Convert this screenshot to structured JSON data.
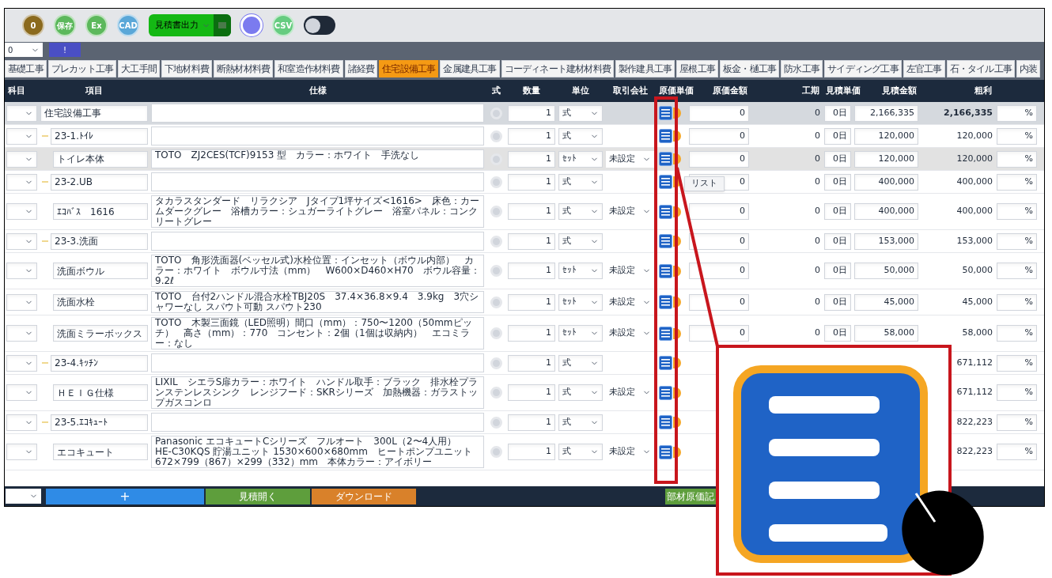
{
  "toolbar": [
    {
      "kind": "round",
      "label": "0",
      "color": "#8b6a1e"
    },
    {
      "kind": "round",
      "label": "保存",
      "color": "#5cb85c"
    },
    {
      "kind": "round",
      "label": "Ex",
      "color": "#5cb85c"
    },
    {
      "kind": "round",
      "label": "CAD",
      "color": "#5aa7d8"
    },
    {
      "kind": "dropdown",
      "label": "見積書出力",
      "color": "#14b814"
    },
    {
      "kind": "ring",
      "color": "#7b7bef"
    },
    {
      "kind": "round",
      "label": "CSV",
      "color": "#66cc80"
    },
    {
      "kind": "toggle",
      "on": false
    }
  ],
  "subbar": {
    "select": "0",
    "button": "!"
  },
  "tabs": [
    {
      "label": "基礎工事",
      "selected": false
    },
    {
      "label": "プレカット工事",
      "selected": false
    },
    {
      "label": "大工手間",
      "selected": false
    },
    {
      "label": "下地材料費",
      "selected": false
    },
    {
      "label": "断熱材材料費",
      "selected": false
    },
    {
      "label": "和室造作材料費",
      "selected": false
    },
    {
      "label": "諸経費",
      "selected": false
    },
    {
      "label": "住宅設備工事",
      "selected": true
    },
    {
      "label": "金属建具工事",
      "selected": false
    },
    {
      "label": "コーディネート建材材料費",
      "selected": false
    },
    {
      "label": "製作建具工事",
      "selected": false
    },
    {
      "label": "屋根工事",
      "selected": false
    },
    {
      "label": "板金・樋工事",
      "selected": false
    },
    {
      "label": "防水工事",
      "selected": false
    },
    {
      "label": "サイディング工事",
      "selected": false
    },
    {
      "label": "左官工事",
      "selected": false
    },
    {
      "label": "石・タイル工事",
      "selected": false
    },
    {
      "label": "内装",
      "selected": false
    }
  ],
  "columns": [
    "科目",
    "項目",
    "仕様",
    "式",
    "数量",
    "単位",
    "取引会社",
    "原価単価",
    "原価金額",
    "工期",
    "見積単価",
    "見積金額",
    "粗利"
  ],
  "rows": [
    {
      "kind": "total",
      "name": "住宅設備工事",
      "qty": "1",
      "unit": "式",
      "cost_unit": "0",
      "cost_total": "0",
      "days": "0日",
      "est_unit": "2,166,335",
      "est_total": "2,166,335",
      "margin": "%",
      "selected": false
    },
    {
      "kind": "group",
      "name": "23-1.ﾄｲﾚ",
      "qty": "1",
      "unit": "式",
      "cost_unit": "0",
      "cost_total": "0",
      "days": "0日",
      "est_unit": "120,000",
      "est_total": "120,000",
      "margin": "%",
      "selected": false
    },
    {
      "kind": "item",
      "name": "トイレ本体",
      "spec": "TOTO　ZJ2CES(TCF)9153 型　カラー：ホワイト　手洗なし",
      "qty": "1",
      "unit": "ｾｯﾄ",
      "company": "未設定",
      "cost_unit": "0",
      "cost_total": "0",
      "days": "0日",
      "est_unit": "120,000",
      "est_total": "120,000",
      "margin": "%",
      "selected": true
    },
    {
      "kind": "group",
      "name": "23-2.UB",
      "qty": "1",
      "unit": "式",
      "cost_unit": "0",
      "cost_total": "0",
      "days": "0日",
      "est_unit": "400,000",
      "est_total": "400,000",
      "margin": "%",
      "selected": false,
      "tooltip": "リスト"
    },
    {
      "kind": "item",
      "name": "ｴｺﾊﾞｽ　1616",
      "spec": "タカラスタンダード　リラクシア　Jタイプ1坪サイズ<1616>　床色：カームダークグレー　浴槽カラー：シュガーライトグレー　浴室パネル：コンクリートグレー",
      "qty": "1",
      "unit": "式",
      "company": "未設定",
      "cost_unit": "0",
      "cost_total": "0",
      "days": "0日",
      "est_unit": "400,000",
      "est_total": "400,000",
      "margin": "%",
      "selected": false
    },
    {
      "kind": "group",
      "name": "23-3.洗面",
      "qty": "1",
      "unit": "式",
      "cost_unit": "0",
      "cost_total": "0",
      "days": "0日",
      "est_unit": "153,000",
      "est_total": "153,000",
      "margin": "%",
      "selected": false
    },
    {
      "kind": "item",
      "name": "洗面ボウル",
      "spec": "TOTO　角形洗面器(ベッセル式)水栓位置：インセット（ボウル内部）　カラー：ホワイト　ボウル寸法（mm）　W600×D460×H70　ボウル容量：9.2ℓ",
      "qty": "1",
      "unit": "ｾｯﾄ",
      "company": "未設定",
      "cost_unit": "0",
      "cost_total": "0",
      "days": "0日",
      "est_unit": "50,000",
      "est_total": "50,000",
      "margin": "%",
      "selected": false
    },
    {
      "kind": "item",
      "name": "洗面水栓",
      "spec": "TOTO　台付2ハンドル混合水栓TBJ20S　37.4×36.8×9.4　3.9kg　3穴シャワーなし スパウト可動 スパウト230",
      "qty": "1",
      "unit": "ｾｯﾄ",
      "company": "未設定",
      "cost_unit": "0",
      "cost_total": "0",
      "days": "0日",
      "est_unit": "45,000",
      "est_total": "45,000",
      "margin": "%",
      "selected": false
    },
    {
      "kind": "item",
      "name": "洗面ミラーボックス",
      "spec": "TOTO　木製三面鏡（LED照明）間口（mm）：750〜1200（50mmピッチ）　高さ（mm）：770　コンセント：2個（1個は収納内）　エコミラー：なし",
      "qty": "1",
      "unit": "ｾｯﾄ",
      "company": "未設定",
      "cost_unit": "0",
      "cost_total": "0",
      "days": "0日",
      "est_unit": "58,000",
      "est_total": "58,000",
      "margin": "%",
      "selected": false
    },
    {
      "kind": "group",
      "name": "23-4.ｷｯﾁﾝ",
      "qty": "1",
      "unit": "式",
      "est_total": "671,112",
      "margin": "%",
      "selected": false
    },
    {
      "kind": "item",
      "name": "ＨＥＩＧ仕様",
      "spec": "LIXIL　シエラS扉カラー：ホワイト　ハンドル取手：ブラック　排水栓プランステンレスシンク　レンジフード：SKRシリーズ　加熱機器：ガラストップガスコンロ",
      "qty": "1",
      "unit": "式",
      "company": "未設定",
      "est_total": "671,112",
      "margin": "%",
      "selected": false
    },
    {
      "kind": "group",
      "name": "23-5.ｴｺｷｭｰﾄ",
      "qty": "1",
      "unit": "式",
      "est_total": "822,223",
      "margin": "%",
      "selected": false
    },
    {
      "kind": "item",
      "name": "エコキュート",
      "spec": "Panasonic エコキュートCシリーズ　フルオート　300L（2〜4人用）　HE-C30KQS 貯湯ユニット 1530×600×680mm　ヒートポンプユニット 672×799（867）×299（332）mm　本体カラー：アイボリー",
      "qty": "1",
      "unit": "式",
      "company": "未設定",
      "est_total": "822,223",
      "margin": "%",
      "selected": false
    }
  ],
  "bottom": {
    "add": "+",
    "buttons": [
      {
        "label": "見積開く",
        "color": "#5e9e3c"
      },
      {
        "label": "ダウンロード",
        "color": "#d9812a"
      },
      {
        "label": "部材原価記",
        "color": "#5e9e3c"
      }
    ]
  }
}
